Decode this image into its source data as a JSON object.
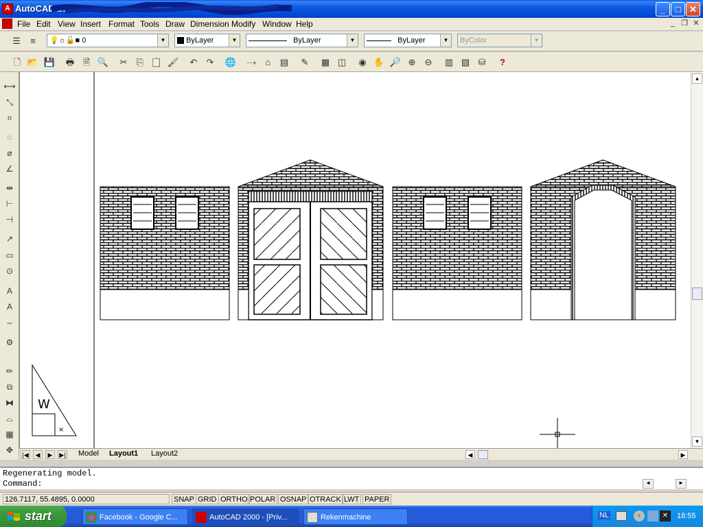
{
  "titlebar": {
    "app_title": "AutoCAD 2000",
    "minimize": "_",
    "maximize": "□",
    "close": "✕"
  },
  "menu": [
    "File",
    "Edit",
    "View",
    "Insert",
    "Format",
    "Tools",
    "Draw",
    "Dimension",
    "Modify",
    "Window",
    "Help"
  ],
  "layers": {
    "current_layer": "0",
    "color": "ByLayer",
    "linetype": "ByLayer",
    "lineweight": "ByLayer",
    "plotstyle": "ByColor"
  },
  "tabs": [
    "Model",
    "Layout1",
    "Layout2"
  ],
  "active_tab": "Layout1",
  "command": {
    "history": "Regenerating model.",
    "prompt": "Command:"
  },
  "status": {
    "coords": "126.7117, 55.4895, 0.0000",
    "toggles": [
      "SNAP",
      "GRID",
      "ORTHO",
      "POLAR",
      "OSNAP",
      "OTRACK",
      "LWT",
      "PAPER"
    ]
  },
  "taskbar": {
    "start": "start",
    "tasks": [
      "Facebook - Google C...",
      "AutoCAD 2000 - [Priv...",
      "Rekenmachine"
    ],
    "language": "NL",
    "clock": "18:55"
  },
  "colors": {
    "taskbar": "#245edc",
    "start": "#3c9a3c",
    "titlebar": "#0545d6"
  }
}
